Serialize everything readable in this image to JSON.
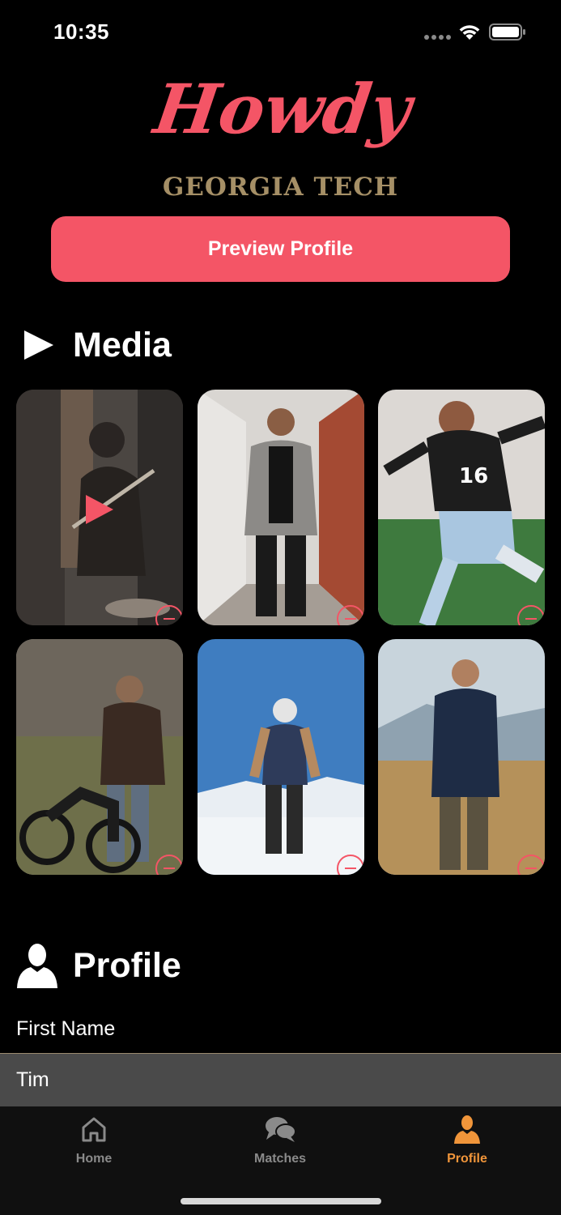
{
  "status_bar": {
    "time": "10:35"
  },
  "header": {
    "logo_text": "Howdy",
    "school": "GEORGIA TECH",
    "preview_button": "Preview Profile"
  },
  "media": {
    "title": "Media",
    "items": [
      {
        "kind": "video",
        "subject": "guitarist-at-concert"
      },
      {
        "kind": "photo",
        "subject": "man-in-blazer-alley"
      },
      {
        "kind": "photo",
        "subject": "soccer-player-16"
      },
      {
        "kind": "photo",
        "subject": "man-with-motorcycle"
      },
      {
        "kind": "photo",
        "subject": "skier-on-mountain"
      },
      {
        "kind": "photo",
        "subject": "man-in-field"
      }
    ]
  },
  "profile": {
    "title": "Profile",
    "fields": [
      {
        "label": "First Name",
        "value": "Tim"
      }
    ]
  },
  "tab_bar": {
    "tabs": [
      {
        "label": "Home",
        "icon": "home-icon",
        "active": false
      },
      {
        "label": "Matches",
        "icon": "chat-bubbles-icon",
        "active": false
      },
      {
        "label": "Profile",
        "icon": "person-icon",
        "active": true
      }
    ]
  },
  "colors": {
    "accent": "#f45566",
    "school_gold": "#a58f66",
    "active_tab": "#f0953a",
    "background": "#000000"
  }
}
